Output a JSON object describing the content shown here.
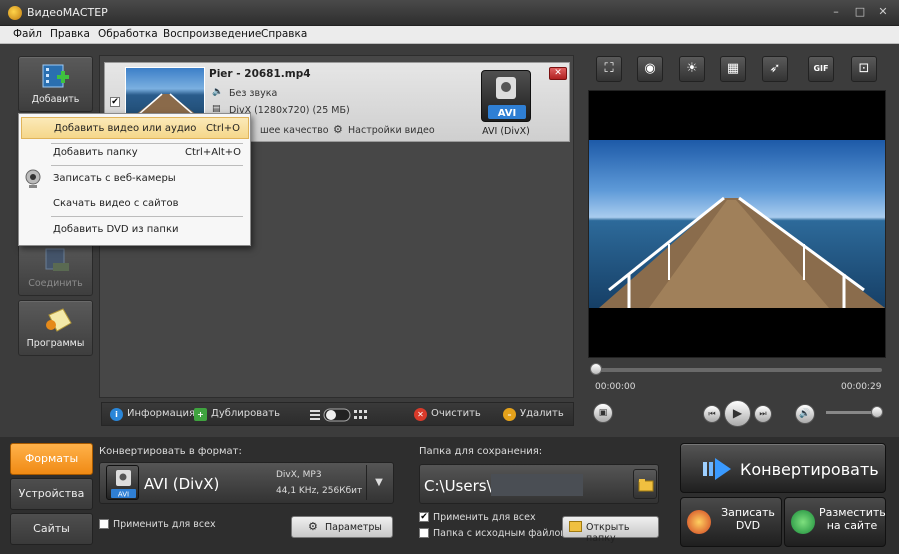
{
  "window": {
    "title": "ВидеоМАСТЕР",
    "minimize": "–",
    "maximize": "□",
    "close": "✕"
  },
  "menu": [
    "Файл",
    "Правка",
    "Обработка",
    "Воспроизведение",
    "Справка"
  ],
  "left_buttons": {
    "add": "Добавить",
    "join": "Соединить",
    "programs": "Программы"
  },
  "dropdown": {
    "items": [
      {
        "label": "Добавить видео или аудио",
        "shortcut": "Ctrl+O"
      },
      {
        "label": "Добавить папку",
        "shortcut": "Ctrl+Alt+O"
      },
      {
        "label": "Записать с веб-камеры",
        "shortcut": ""
      },
      {
        "label": "Скачать видео с сайтов",
        "shortcut": ""
      },
      {
        "label": "Добавить DVD из папки",
        "shortcut": ""
      }
    ]
  },
  "file": {
    "name": "Pier - 20681.mp4",
    "audio": "Без звука",
    "info": "DivX (1280x720) (25 МБ)",
    "quality": "шее качество",
    "settings": "Настройки видео",
    "badge": "AVI",
    "format": "AVI (DivX)",
    "checkbox": "✔"
  },
  "list_toolbar": {
    "info": "Информация",
    "duplicate": "Дублировать",
    "clear": "Очистить",
    "delete": "Удалить"
  },
  "player": {
    "time_start": "00:00:00",
    "time_end": "00:00:29"
  },
  "effects": [
    "crop-icon",
    "vignette-icon",
    "brightness-icon",
    "subtitles-icon",
    "speed-icon",
    "gif-icon",
    "fullscreen-icon"
  ],
  "gif_label": "GIF",
  "tabs": {
    "formats": "Форматы",
    "devices": "Устройства",
    "sites": "Сайты"
  },
  "format_section": {
    "label": "Конвертировать в формат:",
    "name": "AVI (DivX)",
    "detail1": "DivX, MP3",
    "detail2": "44,1 KHz, 256Кбит",
    "badge": "AVI",
    "apply_all": "Применить для всех",
    "params": "Параметры"
  },
  "save_section": {
    "label": "Папка для сохранения:",
    "path": "C:\\Users\\.",
    "apply_all": "Применить для всех",
    "source_folder": "Папка с исходным файлом",
    "open_folder": "Открыть папку",
    "check": "✔"
  },
  "actions": {
    "convert": "Конвертировать",
    "dvd": "Записать DVD",
    "publish": "Разместить на сайте"
  },
  "colors": {
    "accent": "#f08a14",
    "highlight": "#f5d78a"
  }
}
